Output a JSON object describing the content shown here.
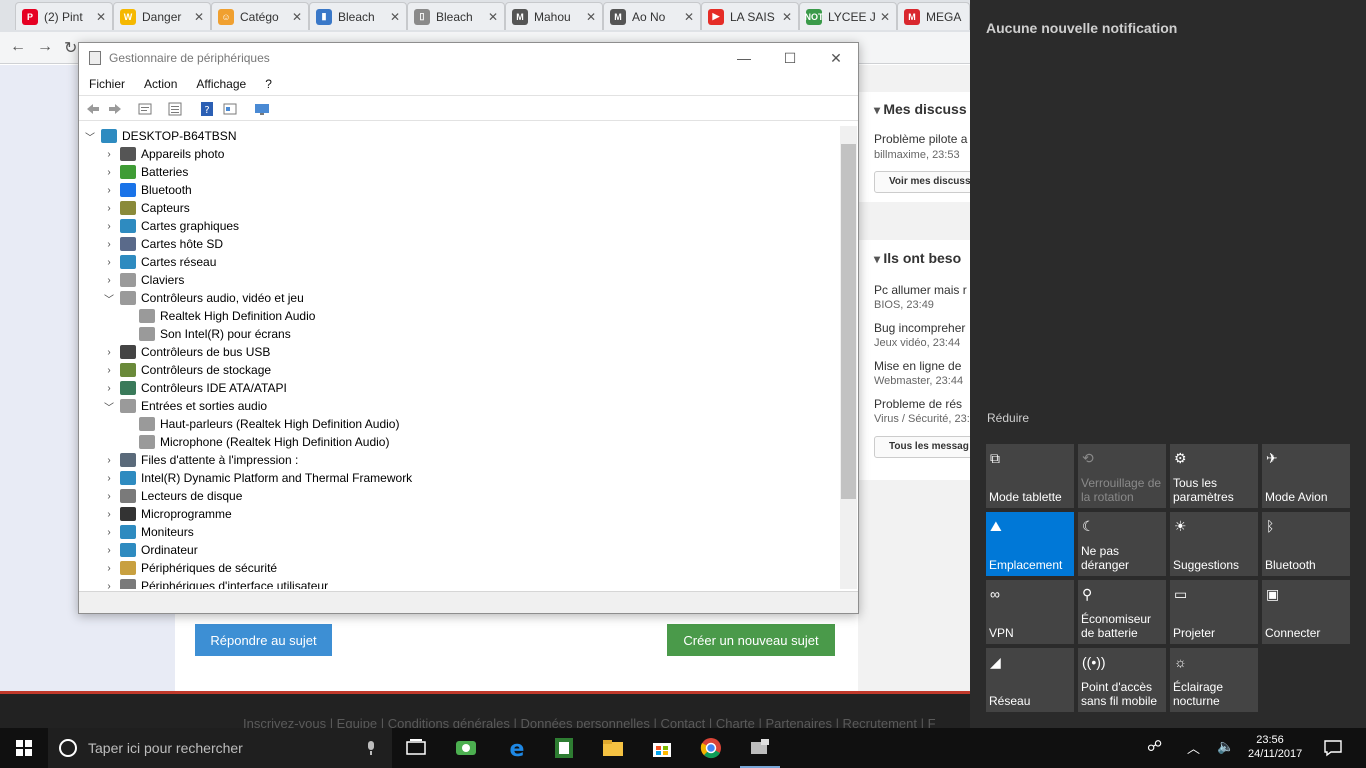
{
  "browser": {
    "tabs": [
      {
        "title": "(2) Pint",
        "favicon_color": "#e60023",
        "glyph": "P"
      },
      {
        "title": "Danger",
        "favicon_color": "#f5b800",
        "glyph": "W"
      },
      {
        "title": "Catégo",
        "favicon_color": "#f0a030",
        "glyph": "☺"
      },
      {
        "title": "Bleach",
        "favicon_color": "#3a78c8",
        "glyph": "▮"
      },
      {
        "title": "Bleach",
        "favicon_color": "#8a8a8a",
        "glyph": "▯"
      },
      {
        "title": "Mahou",
        "favicon_color": "#555555",
        "glyph": "M"
      },
      {
        "title": "Ao No",
        "favicon_color": "#555555",
        "glyph": "M"
      },
      {
        "title": "LA SAIS",
        "favicon_color": "#e52d27",
        "glyph": "▶"
      },
      {
        "title": "LYCEE J",
        "favicon_color": "#3a9a4a",
        "glyph": "NOT"
      },
      {
        "title": "MEGA",
        "favicon_color": "#d9272e",
        "glyph": "M"
      }
    ]
  },
  "webpage": {
    "discussions_title": "Mes discuss",
    "discussion_item": "Problème pilote a",
    "discussion_meta": "billmaxime, 23:53",
    "see_discussions": "Voir mes discuss",
    "need_title": "Ils ont beso",
    "need_items": [
      {
        "title": "Pc allumer mais r",
        "meta": "BIOS, 23:49"
      },
      {
        "title": "Bug incompreher",
        "meta": "Jeux vidéo, 23:44"
      },
      {
        "title": "Mise en ligne de",
        "meta": "Webmaster, 23:44"
      },
      {
        "title": "Probleme de rés",
        "meta": "Virus / Sécurité, 23:4"
      }
    ],
    "all_messages": "Tous les messag",
    "reply_button": "Répondre au sujet",
    "new_topic_button": "Créer un nouveau sujet",
    "footer_links": "Inscrivez-vous | Equipe | Conditions générales | Données personnelles | Contact | Charte | Partenaires | Recrutement | F"
  },
  "device_manager": {
    "title": "Gestionnaire de périphériques",
    "menus": [
      "Fichier",
      "Action",
      "Affichage",
      "?"
    ],
    "root": "DESKTOP-B64TBSN",
    "items": [
      {
        "label": "Appareils photo",
        "level": 1,
        "state": "collapsed",
        "color": "#555555"
      },
      {
        "label": "Batteries",
        "level": 1,
        "state": "collapsed",
        "color": "#3f9c35"
      },
      {
        "label": "Bluetooth",
        "level": 1,
        "state": "collapsed",
        "color": "#1a73e8"
      },
      {
        "label": "Capteurs",
        "level": 1,
        "state": "collapsed",
        "color": "#8a8a3a"
      },
      {
        "label": "Cartes graphiques",
        "level": 1,
        "state": "collapsed",
        "color": "#2e8bc0"
      },
      {
        "label": "Cartes hôte SD",
        "level": 1,
        "state": "collapsed",
        "color": "#5a6a8a"
      },
      {
        "label": "Cartes réseau",
        "level": 1,
        "state": "collapsed",
        "color": "#2e8bc0"
      },
      {
        "label": "Claviers",
        "level": 1,
        "state": "collapsed",
        "color": "#9a9a9a"
      },
      {
        "label": "Contrôleurs audio, vidéo et jeu",
        "level": 1,
        "state": "expanded",
        "color": "#9a9a9a"
      },
      {
        "label": "Realtek High Definition Audio",
        "level": 2,
        "state": "leaf",
        "color": "#9a9a9a"
      },
      {
        "label": "Son Intel(R) pour écrans",
        "level": 2,
        "state": "leaf",
        "color": "#9a9a9a"
      },
      {
        "label": "Contrôleurs de bus USB",
        "level": 1,
        "state": "collapsed",
        "color": "#444444"
      },
      {
        "label": "Contrôleurs de stockage",
        "level": 1,
        "state": "collapsed",
        "color": "#6a8a3a"
      },
      {
        "label": "Contrôleurs IDE ATA/ATAPI",
        "level": 1,
        "state": "collapsed",
        "color": "#3a7a5a"
      },
      {
        "label": "Entrées et sorties audio",
        "level": 1,
        "state": "expanded",
        "color": "#9a9a9a"
      },
      {
        "label": "Haut-parleurs (Realtek High Definition Audio)",
        "level": 2,
        "state": "leaf",
        "color": "#9a9a9a"
      },
      {
        "label": "Microphone (Realtek High Definition Audio)",
        "level": 2,
        "state": "leaf",
        "color": "#9a9a9a"
      },
      {
        "label": "Files d'attente à l'impression :",
        "level": 1,
        "state": "collapsed",
        "color": "#5a6a7a"
      },
      {
        "label": "Intel(R) Dynamic Platform and Thermal Framework",
        "level": 1,
        "state": "collapsed",
        "color": "#2e8bc0"
      },
      {
        "label": "Lecteurs de disque",
        "level": 1,
        "state": "collapsed",
        "color": "#7a7a7a"
      },
      {
        "label": "Microprogramme",
        "level": 1,
        "state": "collapsed",
        "color": "#333333"
      },
      {
        "label": "Moniteurs",
        "level": 1,
        "state": "collapsed",
        "color": "#2e8bc0"
      },
      {
        "label": "Ordinateur",
        "level": 1,
        "state": "collapsed",
        "color": "#2e8bc0"
      },
      {
        "label": "Périphériques de sécurité",
        "level": 1,
        "state": "collapsed",
        "color": "#c8a040"
      },
      {
        "label": "Périphériques d'interface utilisateur",
        "level": 1,
        "state": "collapsed",
        "color": "#7a7a7a"
      }
    ]
  },
  "action_center": {
    "no_notification": "Aucune nouvelle notification",
    "reduce": "Réduire",
    "tiles": [
      {
        "label": "Mode tablette",
        "icon": "⧉",
        "state": "off"
      },
      {
        "label": "Verrouillage de la rotation",
        "icon": "⟲",
        "state": "disabled"
      },
      {
        "label": "Tous les paramètres",
        "icon": "⚙",
        "state": "off"
      },
      {
        "label": "Mode Avion",
        "icon": "✈",
        "state": "off"
      },
      {
        "label": "Emplacement",
        "icon": "⛰",
        "state": "on"
      },
      {
        "label": "Ne pas déranger",
        "icon": "☾",
        "state": "off"
      },
      {
        "label": "Suggestions",
        "icon": "☀",
        "state": "off"
      },
      {
        "label": "Bluetooth",
        "icon": "ᛒ",
        "state": "off"
      },
      {
        "label": "VPN",
        "icon": "∞",
        "state": "off"
      },
      {
        "label": "Économiseur de batterie",
        "icon": "⚲",
        "state": "off"
      },
      {
        "label": "Projeter",
        "icon": "▭",
        "state": "off"
      },
      {
        "label": "Connecter",
        "icon": "▣",
        "state": "off"
      },
      {
        "label": "Réseau",
        "icon": "◢",
        "state": "off"
      },
      {
        "label": "Point d'accès sans fil mobile",
        "icon": "((•))",
        "state": "off"
      },
      {
        "label": "Éclairage nocturne",
        "icon": "☼",
        "state": "off"
      }
    ]
  },
  "taskbar": {
    "search_placeholder": "Taper ici pour rechercher",
    "time": "23:56",
    "date": "24/11/2017"
  }
}
